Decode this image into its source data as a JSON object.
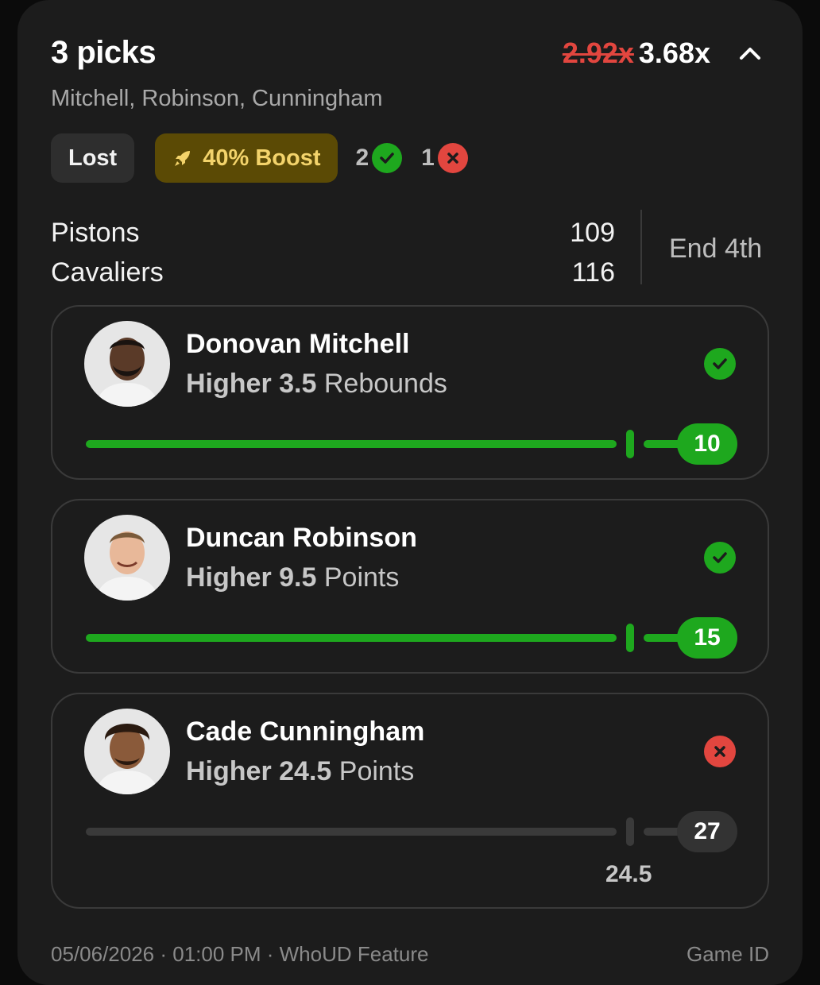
{
  "header": {
    "title": "3 picks",
    "old_multiplier": "2.92x",
    "new_multiplier": "3.68x",
    "players": "Mitchell, Robinson, Cunningham"
  },
  "badges": {
    "status": "Lost",
    "boost": "40% Boost",
    "wins": "2",
    "losses": "1"
  },
  "game": {
    "team1": "Pistons",
    "score1": "109",
    "team2": "Cavaliers",
    "score2": "116",
    "status": "End 4th"
  },
  "picks": [
    {
      "name": "Donovan Mitchell",
      "direction": "Higher",
      "line": "3.5",
      "stat": "Rebounds",
      "value": "10",
      "result": "win",
      "progress": 1.0
    },
    {
      "name": "Duncan Robinson",
      "direction": "Higher",
      "line": "9.5",
      "stat": "Points",
      "value": "15",
      "result": "win",
      "progress": 1.0
    },
    {
      "name": "Cade Cunningham",
      "direction": "Higher",
      "line": "24.5",
      "stat": "Points",
      "value": "27",
      "result": "loss",
      "progress": 0.0,
      "line_label": "24.5"
    }
  ],
  "footer": {
    "left": "05/06/2026 · 01:00 PM · WhoUD Feature",
    "right": "Game ID"
  },
  "colors": {
    "win": "#1ea81e",
    "loss": "#e2463f",
    "boost_bg": "#5b4a05",
    "boost_text": "#f3d36b"
  }
}
